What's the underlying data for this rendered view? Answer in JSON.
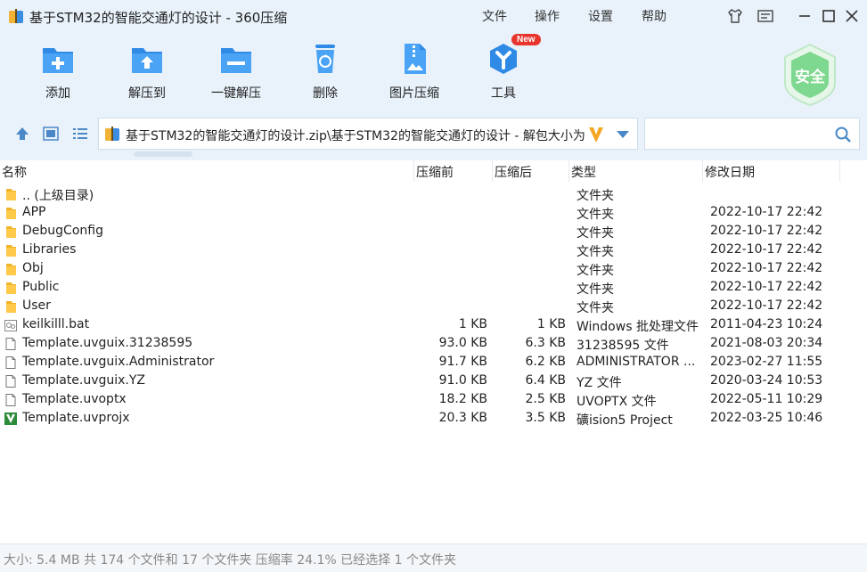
{
  "window": {
    "title": "基于STM32的智能交通灯的设计 - 360压缩",
    "menu": [
      "文件",
      "操作",
      "设置",
      "帮助"
    ]
  },
  "toolbar": {
    "add": "添加",
    "extract_to": "解压到",
    "one_click_extract": "一键解压",
    "delete": "删除",
    "image_compress": "图片压缩",
    "tools": "工具",
    "new_badge": "New",
    "safe": "安全"
  },
  "path": {
    "value": "基于STM32的智能交通灯的设计.zip\\基于STM32的智能交通灯的设计 - 解包大小为"
  },
  "columns": {
    "name": "名称",
    "size": "压缩前",
    "compressed": "压缩后",
    "type": "类型",
    "modified": "修改日期"
  },
  "files": [
    {
      "icon": "folder-icon",
      "name": ".. (上级目录)",
      "size": "",
      "compressed": "",
      "type": "文件夹",
      "modified": ""
    },
    {
      "icon": "folder-icon",
      "name": "APP",
      "size": "",
      "compressed": "",
      "type": "文件夹",
      "modified": "2022-10-17 22:42"
    },
    {
      "icon": "folder-icon",
      "name": "DebugConfig",
      "size": "",
      "compressed": "",
      "type": "文件夹",
      "modified": "2022-10-17 22:42"
    },
    {
      "icon": "folder-icon",
      "name": "Libraries",
      "size": "",
      "compressed": "",
      "type": "文件夹",
      "modified": "2022-10-17 22:42"
    },
    {
      "icon": "folder-icon",
      "name": "Obj",
      "size": "",
      "compressed": "",
      "type": "文件夹",
      "modified": "2022-10-17 22:42"
    },
    {
      "icon": "folder-icon",
      "name": "Public",
      "size": "",
      "compressed": "",
      "type": "文件夹",
      "modified": "2022-10-17 22:42"
    },
    {
      "icon": "folder-icon",
      "name": "User",
      "size": "",
      "compressed": "",
      "type": "文件夹",
      "modified": "2022-10-17 22:42"
    },
    {
      "icon": "batch-file-icon",
      "name": "keilkilll.bat",
      "size": "1 KB",
      "compressed": "1 KB",
      "type": "Windows 批处理文件",
      "modified": "2011-04-23 10:24"
    },
    {
      "icon": "document-icon",
      "name": "Template.uvguix.31238595",
      "size": "93.0 KB",
      "compressed": "6.3 KB",
      "type": "31238595 文件",
      "modified": "2021-08-03 20:34"
    },
    {
      "icon": "document-icon",
      "name": "Template.uvguix.Administrator",
      "size": "91.7 KB",
      "compressed": "6.2 KB",
      "type": "ADMINISTRATOR ...",
      "modified": "2023-02-27 11:55"
    },
    {
      "icon": "document-icon",
      "name": "Template.uvguix.YZ",
      "size": "91.0 KB",
      "compressed": "6.4 KB",
      "type": "YZ 文件",
      "modified": "2020-03-24 10:53"
    },
    {
      "icon": "document-icon",
      "name": "Template.uvoptx",
      "size": "18.2 KB",
      "compressed": "2.5 KB",
      "type": "UVOPTX 文件",
      "modified": "2022-05-11 10:29"
    },
    {
      "icon": "keil-project-icon",
      "name": "Template.uvprojx",
      "size": "20.3 KB",
      "compressed": "3.5 KB",
      "type": "礦ision5 Project",
      "modified": "2022-03-25 10:46"
    }
  ],
  "status": {
    "text": "大小: 5.4 MB 共 174 个文件和 17 个文件夹 压缩率 24.1% 已经选择 1 个文件夹"
  }
}
